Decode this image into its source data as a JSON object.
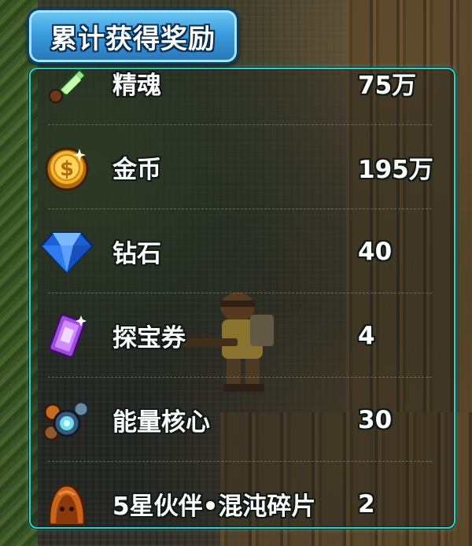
{
  "header": {
    "title": "累计获得奖励"
  },
  "rewards": [
    {
      "name": "精魂",
      "value": "75万",
      "icon": "spirit-vial-icon"
    },
    {
      "name": "金币",
      "value": "195万",
      "icon": "gold-coin-icon"
    },
    {
      "name": "钻石",
      "value": "40",
      "icon": "diamond-icon"
    },
    {
      "name": "探宝券",
      "value": "4",
      "icon": "treasure-ticket-icon"
    },
    {
      "name": "能量核心",
      "value": "30",
      "icon": "energy-core-icon"
    },
    {
      "name": "5星伙伴•混沌碎片",
      "value": "2",
      "icon": "chaos-fragment-icon"
    }
  ],
  "colors": {
    "panel_border": "#29d6cf",
    "title_tab": "#3a9ede",
    "text": "#ffffff"
  }
}
